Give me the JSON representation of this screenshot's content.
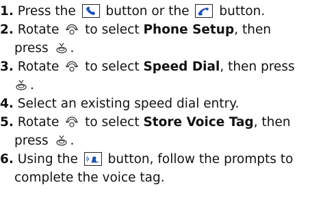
{
  "steps": [
    {
      "num": "1.",
      "t1": "Press the",
      "t2": "button or the",
      "t3": "button."
    },
    {
      "num": "2.",
      "t1": "Rotate",
      "t2": "to select",
      "bold": "Phone Setup",
      "t3": ", then",
      "c1": "press",
      "c2": "."
    },
    {
      "num": "3.",
      "t1": "Rotate",
      "t2": "to select",
      "bold": "Speed Dial",
      "t3": ", then press",
      "c2": "."
    },
    {
      "num": "4.",
      "t1": "Select an existing speed dial entry."
    },
    {
      "num": "5.",
      "t1": "Rotate",
      "t2": "to select",
      "bold": "Store Voice Tag",
      "t3": ", then",
      "c1": "press",
      "c2": "."
    },
    {
      "num": "6.",
      "t1": "Using the",
      "t2": "button, follow the prompts to",
      "c1": "complete the voice tag."
    }
  ]
}
